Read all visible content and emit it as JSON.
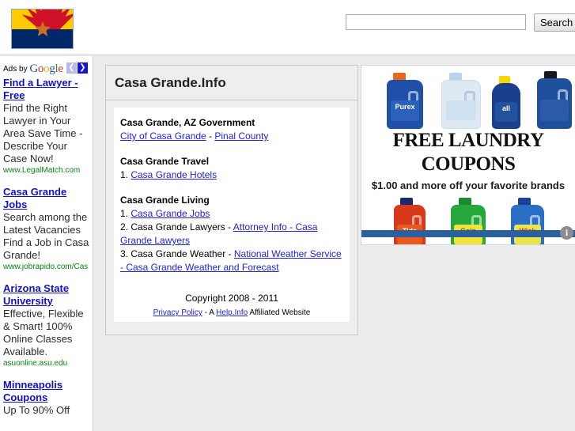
{
  "header": {
    "flag_icon": "arizona-flag-icon",
    "search": {
      "value": "",
      "placeholder": "",
      "button_label": "Search"
    }
  },
  "ads_sidebar": {
    "label_prefix": "Ads by",
    "label_brand": "Google",
    "prev_arrow": "❮",
    "next_arrow": "❯",
    "ads": [
      {
        "title": "Find a Lawyer - Free",
        "body": "Find the Right Lawyer in Your Area Save Time - Describe Your Case Now!",
        "url": "www.LegalMatch.com"
      },
      {
        "title": "Casa Grande Jobs",
        "body": "Search among the Latest Vacancies Find a Job in Casa Grande!",
        "url": "www.jobrapido.com/Cas"
      },
      {
        "title": "Arizona State University",
        "body": "Effective, Flexible & Smart! 100% Online Classes Available.",
        "url": "asuonline.asu.edu"
      },
      {
        "title": "Minneapolis Coupons",
        "body": "Up To 90% Off",
        "url": ""
      }
    ]
  },
  "content": {
    "title": "Casa Grande.Info",
    "sections": [
      {
        "heading": "Casa Grande, AZ Government",
        "line_prefix": "",
        "link1": "City of Casa Grande",
        "separator": " - ",
        "link2": "Pinal County"
      }
    ],
    "travel": {
      "heading": "Casa Grande Travel",
      "items": [
        {
          "number": "1. ",
          "text": "",
          "link": "Casa Grande Hotels"
        }
      ]
    },
    "living": {
      "heading": "Casa Grande Living",
      "items": [
        {
          "number": "1. ",
          "text": "",
          "link": "Casa Grande Jobs"
        },
        {
          "number": "2. ",
          "text": "Casa Grande Lawyers - ",
          "link": "Attorney Info - Casa Grande Lawyers"
        },
        {
          "number": "3. ",
          "text": "Casa Grande Weather - ",
          "link": "National Weather Service - Casa Grande Weather and Forecast"
        }
      ]
    },
    "copyright": "Copyright 2008 - 2011",
    "footer": {
      "privacy_link": "Privacy Policy",
      "mid_text": " - A ",
      "help_link": "Help.Info",
      "tail_text": " Affiliated Website"
    }
  },
  "banner_ad": {
    "headline": "FREE LAUNDRY COUPONS",
    "subtext": "$1.00 and more off your favorite brands",
    "top_bottles": [
      {
        "name": "Purex",
        "color": "#1f4fa8",
        "cap": "#e8691a",
        "label_bg": "#2b61bd",
        "label_color": "#ffffff"
      },
      {
        "name": "",
        "color": "#dfe9f4",
        "cap": "#bcd2e8",
        "label_bg": "#cfe0f0",
        "label_color": "#3a7ab8"
      },
      {
        "name": "all",
        "color": "#1a3f8f",
        "cap": "#f5d800",
        "label_bg": "#23529f",
        "label_color": "#ffffff"
      },
      {
        "name": "",
        "color": "#1d4f9c",
        "cap": "#15181c",
        "label_bg": "#2a5aa8",
        "label_color": "#cfe0f0"
      }
    ],
    "bottom_bottles": [
      {
        "name": "Tide",
        "color": "#d8391a",
        "cap": "#1b2a6b",
        "label_bg": "#e8581f",
        "label_color": "#ffffff"
      },
      {
        "name": "Gain",
        "color": "#27a83c",
        "cap": "#1e8a30",
        "label_bg": "#f2e33a",
        "label_color": "#1d7a2c"
      },
      {
        "name": "Wisk",
        "color": "#2a6fc4",
        "cap": "#1b3f9b",
        "label_bg": "#e9e54a",
        "label_color": "#d8391a"
      }
    ],
    "adchoices_icon": "info-icon",
    "adchoices_label": "i"
  }
}
